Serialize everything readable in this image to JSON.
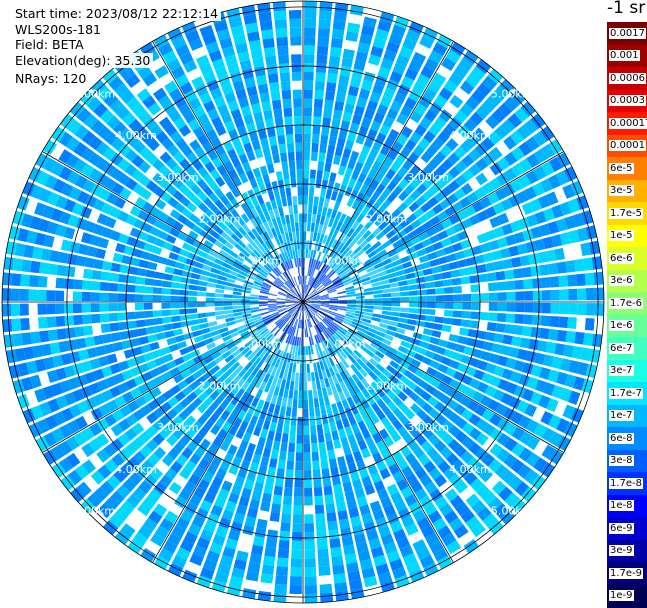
{
  "header": {
    "start_time": "Start time: 2023/08/12 22:12:14",
    "instrument": "WLS200s-181",
    "field": "Field: BETA",
    "elevation": "Elevation(deg): 35.30",
    "nrays": "NRays: 120"
  },
  "colorbar": {
    "unit": "-1 sr",
    "entries": [
      {
        "label": "0.0017",
        "color": "#7a0000"
      },
      {
        "label": "0.001",
        "color": "#9e0000"
      },
      {
        "label": "0.0006",
        "color": "#c40000"
      },
      {
        "label": "0.0003",
        "color": "#e80000"
      },
      {
        "label": "0.00017",
        "color": "#ff1a00"
      },
      {
        "label": "0.0001",
        "color": "#ff4d00"
      },
      {
        "label": "6e-5",
        "color": "#ff8000"
      },
      {
        "label": "3e-5",
        "color": "#ffb000"
      },
      {
        "label": "1.7e-5",
        "color": "#ffd900"
      },
      {
        "label": "1e-5",
        "color": "#ffff00"
      },
      {
        "label": "6e-6",
        "color": "#d9ff26"
      },
      {
        "label": "3e-6",
        "color": "#b3ff4d"
      },
      {
        "label": "1.7e-6",
        "color": "#8cff73"
      },
      {
        "label": "1e-6",
        "color": "#66ff99"
      },
      {
        "label": "6e-7",
        "color": "#40ffc0"
      },
      {
        "label": "3e-7",
        "color": "#1affe6"
      },
      {
        "label": "1.7e-7",
        "color": "#00e6ff"
      },
      {
        "label": "1e-7",
        "color": "#00b8ff"
      },
      {
        "label": "6e-8",
        "color": "#008cff"
      },
      {
        "label": "3e-8",
        "color": "#0060ff"
      },
      {
        "label": "1.7e-8",
        "color": "#0033ff"
      },
      {
        "label": "1e-8",
        "color": "#0000ff"
      },
      {
        "label": "6e-9",
        "color": "#0000d0"
      },
      {
        "label": "3e-9",
        "color": "#0000a6"
      },
      {
        "label": "1.7e-9",
        "color": "#00007a"
      },
      {
        "label": "1e-9",
        "color": "#000055"
      }
    ]
  },
  "chart_data": {
    "type": "heatmap",
    "projection": "polar PPI scan",
    "range_rings_km": [
      1,
      2,
      3,
      4,
      5
    ],
    "ring_labels": [
      "1.00km",
      "2.00km",
      "3.00km",
      "4.00km",
      "5.00km"
    ],
    "max_range_km": 5.1,
    "rays": 120,
    "azimuth_lines_deg": [
      0,
      30,
      60,
      90,
      120,
      150,
      180,
      210,
      240,
      270,
      300,
      330
    ],
    "typical_value_range": [
      "1e-8",
      "1e-7"
    ],
    "dominant_colors": [
      "#0096ff",
      "#00b8ff",
      "#0080ff",
      "#00d8ff"
    ]
  }
}
